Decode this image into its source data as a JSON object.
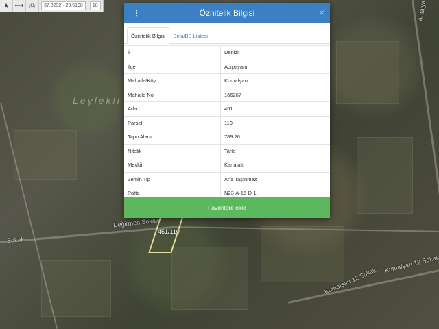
{
  "toolbar": {
    "coords": "37.3232 · 29.5108",
    "zoom": "18"
  },
  "map": {
    "place_label": "Leylekli",
    "roads": [
      "Değirmen Sokak",
      "Sokak",
      "Kumafşarı 12 Sokak",
      "Kumafşarı 17 Sokak",
      "Antalya Karayolu"
    ],
    "parcel_label": "451/110"
  },
  "modal": {
    "title": "Öznitelik Bilgisi",
    "tabs": [
      "Öznitelik Bilgisi",
      "Bina/BB Listesi"
    ],
    "rows": [
      {
        "key": "İl",
        "value": "Denizli"
      },
      {
        "key": "İlçe",
        "value": "Acıpayam"
      },
      {
        "key": "Mahalle/Köy",
        "value": "Kumafşarı"
      },
      {
        "key": "Mahalle No",
        "value": "166267"
      },
      {
        "key": "Ada",
        "value": "451"
      },
      {
        "key": "Parsel",
        "value": "110"
      },
      {
        "key": "Tapu Alanı",
        "value": "789.26"
      },
      {
        "key": "Nitelik",
        "value": "Tarla"
      },
      {
        "key": "Mevkii",
        "value": "Kanalaltı"
      },
      {
        "key": "Zemin Tip",
        "value": "Ana Taşınmaz"
      },
      {
        "key": "Pafta",
        "value": "N23-A-16-D-1"
      }
    ],
    "favorite_button": "Favorilere ekle"
  },
  "colors": {
    "header": "#3a80c3",
    "favorite": "#5cb85c"
  }
}
